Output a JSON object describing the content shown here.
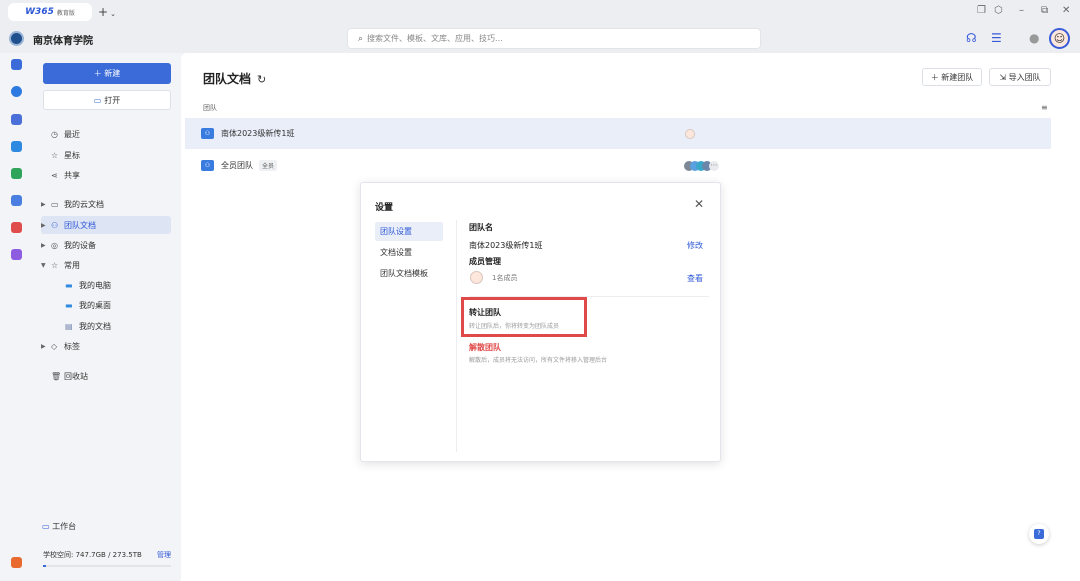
{
  "titlebar": {
    "brand": "W365",
    "edition": "教育版",
    "new_tab_icon": "+",
    "window_controls": [
      "min-icon",
      "restore-icon",
      "close-icon"
    ]
  },
  "topbar": {
    "school_name": "南京体育学院",
    "search_placeholder": "搜索文件、模板、文库、应用、技巧..."
  },
  "sidebar": {
    "new_label": "新建",
    "open_label": "打开",
    "recent": "最近",
    "starred": "星标",
    "shared": "共享",
    "my_cloud": "我的云文档",
    "team_docs": "团队文档",
    "my_devices": "我的设备",
    "common": "常用",
    "my_computer": "我的电脑",
    "my_desktop": "我的桌面",
    "my_documents": "我的文档",
    "tags": "标签",
    "trash": "回收站",
    "workbench": "工作台",
    "space_label": "学校空间: 747.7GB / 273.5TB",
    "manage": "管理",
    "space_used_fraction": 0.003
  },
  "main": {
    "title": "团队文档",
    "new_team": "新建团队",
    "import_team": "导入团队",
    "column_header": "团队",
    "teams": [
      {
        "name": "南体2023级新传1班",
        "tag": ""
      },
      {
        "name": "全员团队",
        "tag": "全员"
      }
    ]
  },
  "dialog": {
    "title": "设置",
    "nav": [
      "团队设置",
      "文档设置",
      "团队文档模板"
    ],
    "team_name_label": "团队名",
    "team_name_value": "南体2023级新传1班",
    "edit": "修改",
    "members_label": "成员管理",
    "members_count": "1名成员",
    "view": "查看",
    "transfer_title": "转让团队",
    "transfer_desc": "转让团队后，你将转变为团队成员",
    "dissolve_title": "解散团队",
    "dissolve_desc": "解散后，成员将无法访问，所有文件将移入管理后台"
  },
  "colors": {
    "accent": "#3a6bd8",
    "highlight_box": "#e04949",
    "danger": "#e04b4b"
  }
}
